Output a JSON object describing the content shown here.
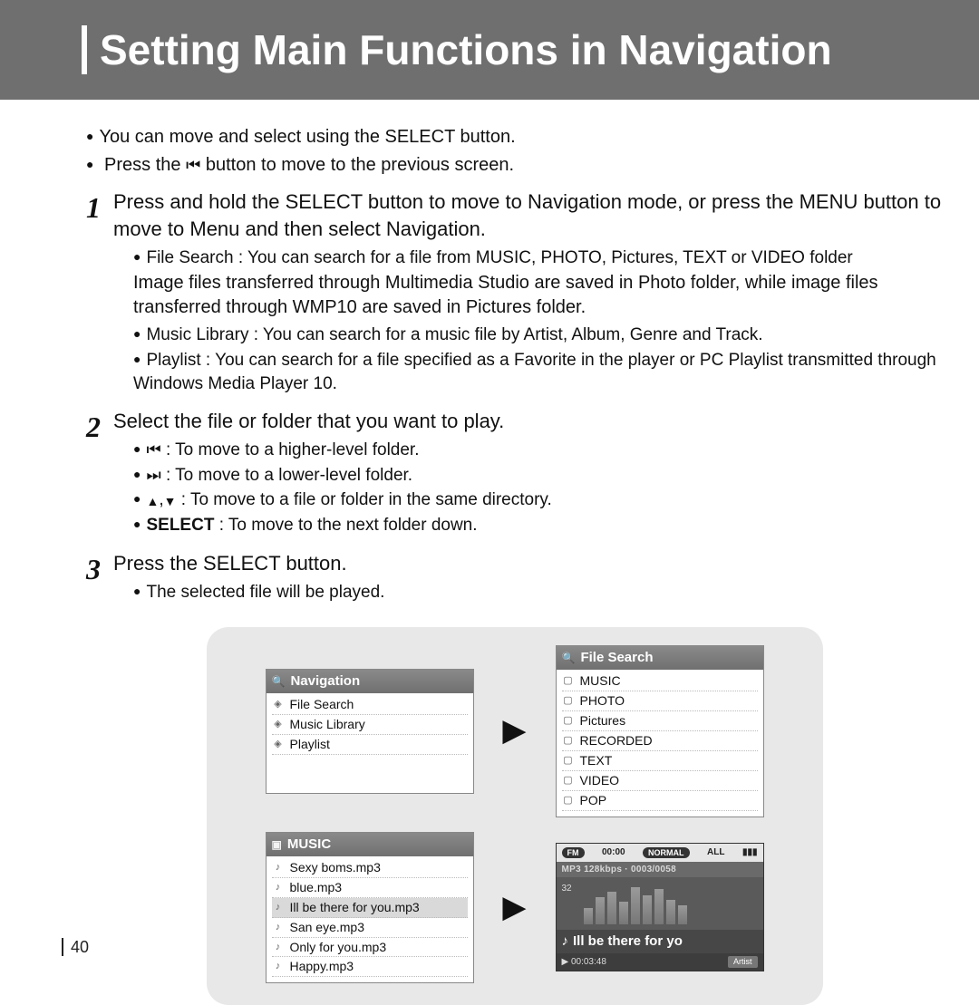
{
  "header": {
    "title": "Setting Main Functions in Navigation"
  },
  "intro": {
    "line1": "You can move and select using the SELECT button.",
    "line2_a": "Press the ",
    "line2_b": " button to move to the previous screen."
  },
  "step1": {
    "text": "Press and hold the SELECT button to move to Navigation mode, or press the MENU button to move to Menu and then select Navigation.",
    "b1": "File Search : You can search for a file from MUSIC, PHOTO, Pictures, TEXT or VIDEO folder",
    "note": "Image files transferred through Multimedia Studio are saved in Photo folder, while image files transferred through WMP10 are saved in Pictures folder.",
    "b2": "Music Library : You can search for a music file by Artist, Album, Genre and Track.",
    "b3": "Playlist : You can search for a file specified as a Favorite in the player or PC Playlist transmitted through Windows Media Player 10."
  },
  "step2": {
    "text": "Select the file or folder that you want to play.",
    "c1": ": To move to a higher-level folder.",
    "c2": ": To move to a lower-level folder.",
    "c3": ": To move to a file or folder in the same directory.",
    "c4_label": "SELECT",
    "c4": " : To move to the next folder down."
  },
  "step3": {
    "text": "Press the SELECT button.",
    "b1": "The selected file will be played."
  },
  "screens": {
    "nav": {
      "title": "Navigation",
      "items": [
        "File Search",
        "Music Library",
        "Playlist"
      ]
    },
    "fileSearch": {
      "title": "File Search",
      "items": [
        "MUSIC",
        "PHOTO",
        "Pictures",
        "RECORDED",
        "TEXT",
        "VIDEO",
        "POP"
      ]
    },
    "music": {
      "title": "MUSIC",
      "items": [
        "Sexy boms.mp3",
        "blue.mp3",
        "Ill be there for you.mp3",
        "San eye.mp3",
        "Only for you.mp3",
        "Happy.mp3"
      ],
      "selectedIndex": 2
    },
    "player": {
      "time_top": "00:00",
      "mode": "NORMAL",
      "repeat": "ALL",
      "bitrate": "128kbps",
      "track": "0003/0058",
      "format": "MP3",
      "eq_num": "32",
      "title": "Ill be there for yo",
      "elapsed": "00:03:48",
      "artist_label": "Artist",
      "fm": "FM"
    }
  },
  "page": "40"
}
